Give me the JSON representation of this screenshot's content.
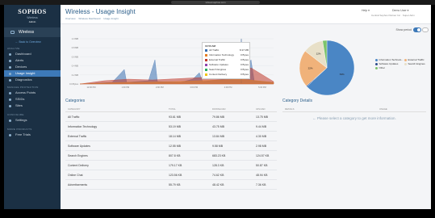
{
  "browser": {
    "url": "virtual.sophos.com"
  },
  "sidebar": {
    "brand": "SOPHOS",
    "product": "Wireless",
    "role": "Admin",
    "top_item": "Wireless",
    "back_link": "← Back to Overview",
    "sections": [
      {
        "label": "Analyze",
        "items": [
          {
            "label": "Dashboard",
            "active": false
          },
          {
            "label": "Alerts",
            "active": false
          },
          {
            "label": "Devices",
            "active": false
          },
          {
            "label": "Usage Insight",
            "active": true
          },
          {
            "label": "Diagnostics",
            "active": false
          }
        ]
      },
      {
        "label": "Manage Protection",
        "items": [
          {
            "label": "Access Points",
            "active": false
          },
          {
            "label": "SSIDs",
            "active": false
          },
          {
            "label": "Sites",
            "active": false
          }
        ]
      },
      {
        "label": "Configure",
        "items": [
          {
            "label": "Settings",
            "active": false
          }
        ]
      },
      {
        "label": "More Products",
        "items": [
          {
            "label": "Free Trials",
            "active": false
          }
        ]
      }
    ]
  },
  "header": {
    "title": "Wireless - Usage Insight",
    "breadcrumbs": [
      "Overview",
      "Wireless Dashboard",
      "Usage Insight"
    ],
    "help": "Help ▾",
    "user": "Demo User ▾",
    "org": "Central Sophos Partner Inc · Super Adm"
  },
  "toolbar": {
    "show_period": "Show period",
    "toggle_label": "24h"
  },
  "chart_data": [
    {
      "type": "area",
      "x_ticks": [
        "12:00 PM",
        "1:00 PM",
        "2:00 PM",
        "3:00 PM",
        "4:00 PM",
        "5:00 PM"
      ],
      "y_ticks": [
        "0.0 Bytes",
        "0.2 MB",
        "0.4 MB",
        "0.6 MB",
        "0.8 MB",
        "1.0 MB"
      ],
      "tooltip": {
        "time": "10:50 AM",
        "rows": [
          {
            "name": "All Traffic",
            "value": "8.37 MB",
            "color": "#3a6fb0"
          },
          {
            "name": "Information Technology",
            "value": "0 Bytes",
            "color": "#e67e22"
          },
          {
            "name": "External Traffic",
            "value": "0 Bytes",
            "color": "#c0392b"
          },
          {
            "name": "Software Updates",
            "value": "0 Bytes",
            "color": "#8e44ad"
          },
          {
            "name": "Search Engines",
            "value": "0 Bytes",
            "color": "#27ae60"
          },
          {
            "name": "Content Delivery",
            "value": "0 Bytes",
            "color": "#f1c40f"
          }
        ]
      }
    },
    {
      "type": "pie",
      "slices": [
        {
          "name": "Information Technolo...",
          "value": 63,
          "label": "63%",
          "color": "#4a86c5"
        },
        {
          "name": "Software Updates",
          "value": 0.5,
          "label": "",
          "color": "#2c4a8a"
        },
        {
          "name": "External Traffic",
          "value": 22,
          "label": "22%",
          "color": "#f0b27a"
        },
        {
          "name": "Search Engines",
          "value": 12,
          "label": "12%",
          "color": "#e8e0c8"
        },
        {
          "name": "Other",
          "value": 2.5,
          "label": "",
          "color": "#7dc36b"
        }
      ]
    }
  ],
  "categories": {
    "title": "Categories",
    "columns": [
      "Category",
      "Total",
      "Download",
      "Upload"
    ],
    "rows": [
      [
        "All Traffic",
        "93.61 MB",
        "79.86 MB",
        "13.75 MB"
      ],
      [
        "Information Technology",
        "53.19 MB",
        "43.75 MB",
        "9.44 MB"
      ],
      [
        "External Traffic",
        "18.14 MB",
        "13.84 MB",
        "4.30 MB"
      ],
      [
        "Software Updates",
        "12.55 MB",
        "9.58 MB",
        "2.98 MB"
      ],
      [
        "Search Engines",
        "807.8 KB",
        "683.23 KB",
        "124.57 KB"
      ],
      [
        "Content Delivery",
        "179.17 KB",
        "128.3 KB",
        "50.87 KB"
      ],
      [
        "Online Chat",
        "123.56 KB",
        "74.62 KB",
        "48.94 KB"
      ],
      [
        "Advertisements",
        "55.79 KB",
        "48.42 KB",
        "7.36 KB"
      ]
    ]
  },
  "details": {
    "title": "Category Details",
    "columns": [
      "Details",
      "Usage"
    ],
    "empty_message": "← Please select a category to get more information."
  }
}
